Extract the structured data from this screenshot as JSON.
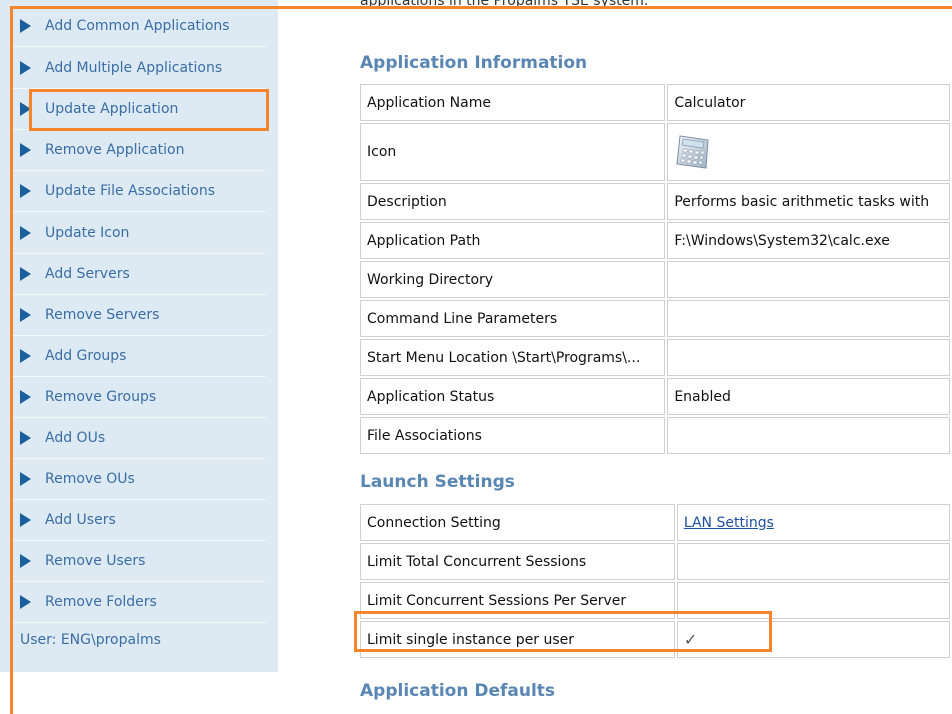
{
  "sidebar": {
    "items": [
      {
        "label": "Add Common Applications"
      },
      {
        "label": "Add Multiple Applications"
      },
      {
        "label": "Update Application"
      },
      {
        "label": "Remove Application"
      },
      {
        "label": "Update File Associations"
      },
      {
        "label": "Update Icon"
      },
      {
        "label": "Add Servers"
      },
      {
        "label": "Remove Servers"
      },
      {
        "label": "Add Groups"
      },
      {
        "label": "Remove Groups"
      },
      {
        "label": "Add OUs"
      },
      {
        "label": "Remove OUs"
      },
      {
        "label": "Add Users"
      },
      {
        "label": "Remove Users"
      },
      {
        "label": "Remove Folders"
      }
    ],
    "user": "User: ENG\\propalms"
  },
  "main": {
    "top_text": "applications in the Propalms TSE system.",
    "app_info": {
      "heading": "Application Information",
      "rows": [
        {
          "key": "Application Name",
          "value": "Calculator"
        },
        {
          "key": "Icon",
          "value": "",
          "icon": "calculator-icon"
        },
        {
          "key": "Description",
          "value": "Performs basic arithmetic tasks with"
        },
        {
          "key": "Application Path",
          "value": "F:\\Windows\\System32\\calc.exe"
        },
        {
          "key": "Working Directory",
          "value": ""
        },
        {
          "key": "Command Line Parameters",
          "value": ""
        },
        {
          "key": "Start Menu Location \\Start\\Programs\\...",
          "value": ""
        },
        {
          "key": "Application Status",
          "value": "Enabled"
        },
        {
          "key": "File Associations",
          "value": ""
        }
      ]
    },
    "launch": {
      "heading": "Launch Settings",
      "rows": [
        {
          "key": "Connection Setting",
          "value": "LAN Settings",
          "link": true
        },
        {
          "key": "Limit Total Concurrent Sessions",
          "value": ""
        },
        {
          "key": "Limit Concurrent Sessions Per Server",
          "value": ""
        },
        {
          "key": "Limit single instance per user",
          "value": "✓"
        }
      ]
    },
    "defaults": {
      "heading": "Application Defaults"
    }
  },
  "colors": {
    "highlight": "#f5852a",
    "sidebar_bg": "#dde9f3",
    "link": "#3a6ea5",
    "section_heading": "#5a86b3"
  }
}
